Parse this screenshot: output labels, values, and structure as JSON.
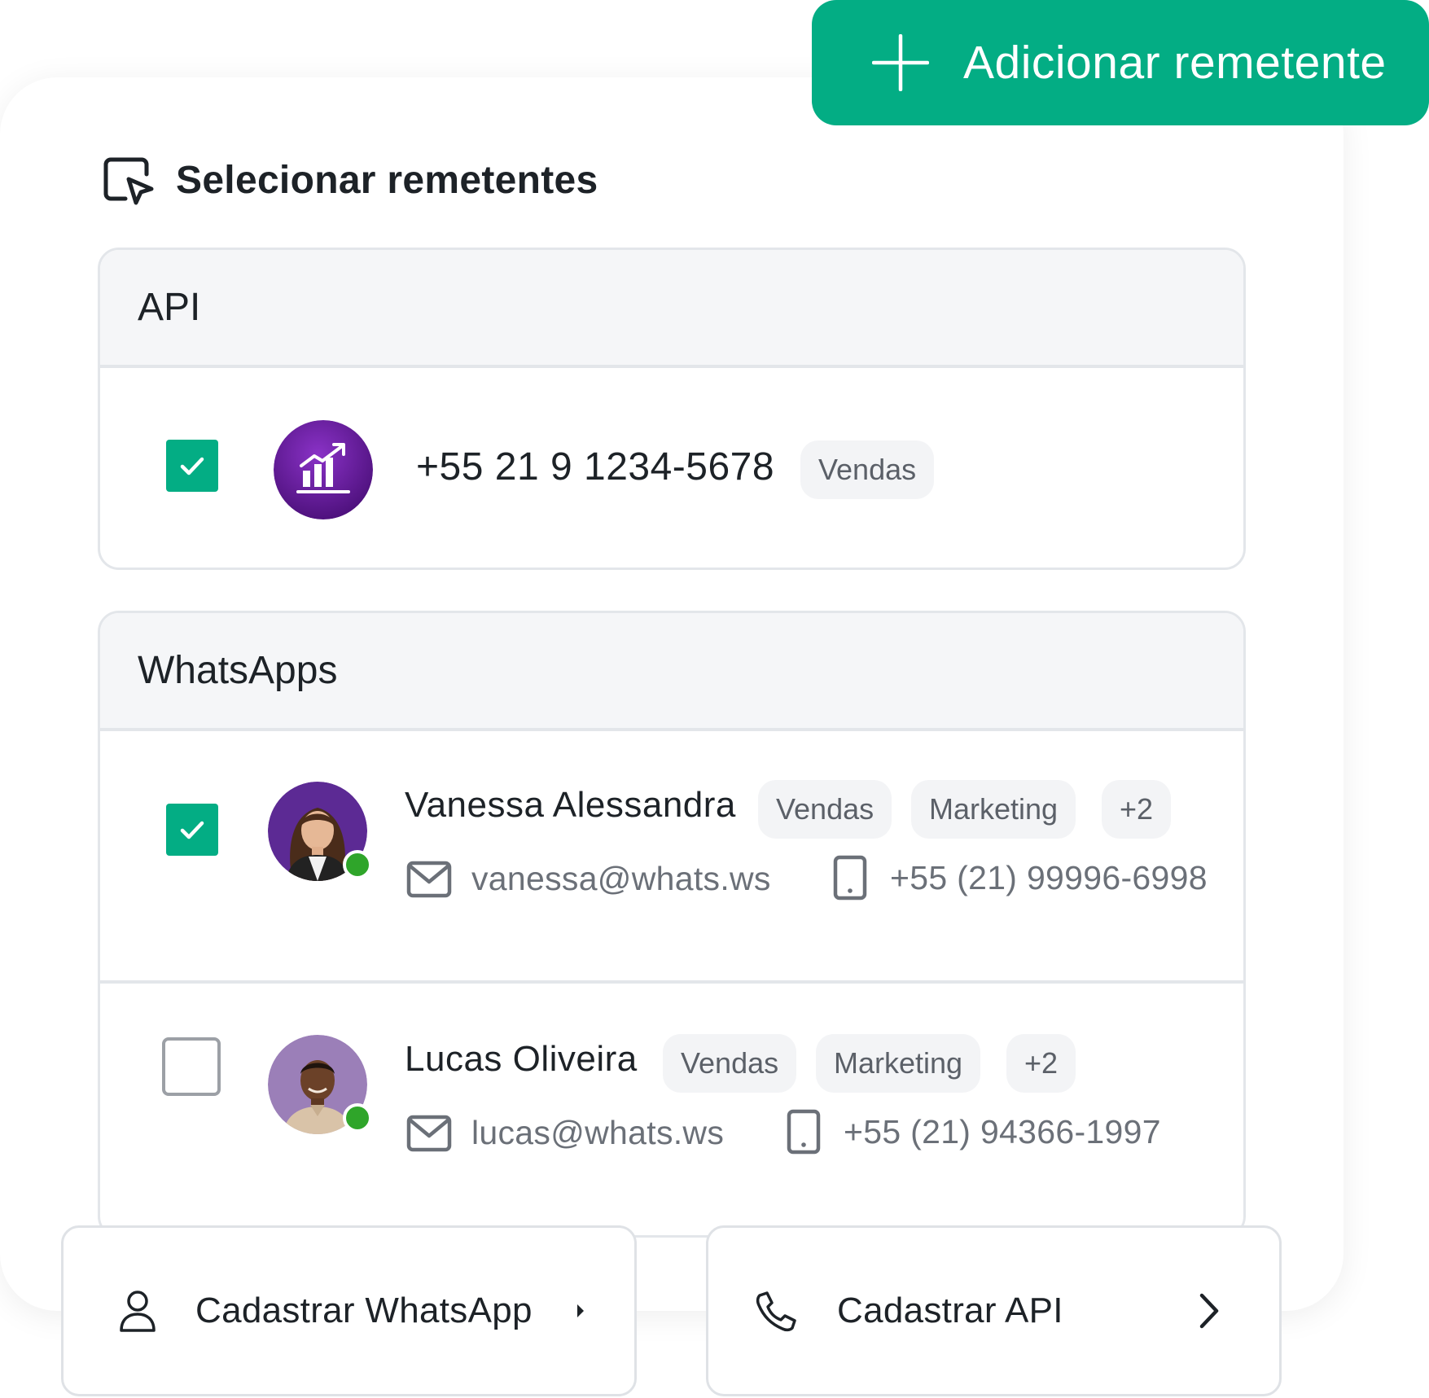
{
  "add_button": {
    "label": "Adicionar remetente",
    "icon": "plus-icon",
    "color": "#03ad84"
  },
  "section": {
    "title": "Selecionar remetentes",
    "icon": "select-cursor-icon"
  },
  "api_group": {
    "title": "API",
    "sender": {
      "checked": true,
      "avatar_icon": "chart-growth-icon",
      "avatar_color": "#6a1fa0",
      "phone": "+55 21 9 1234-5678",
      "tag": "Vendas"
    }
  },
  "whatsapp_group": {
    "title": "WhatsApps",
    "senders": [
      {
        "checked": true,
        "name": "Vanessa Alessandra",
        "tags": [
          "Vendas",
          "Marketing",
          "+2"
        ],
        "email": "vanessa@whats.ws",
        "phone": "+55 (21) 99996-6998",
        "online": true
      },
      {
        "checked": false,
        "name": "Lucas Oliveira",
        "tags": [
          "Vendas",
          "Marketing",
          "+2"
        ],
        "email": "lucas@whats.ws",
        "phone": "+55 (21) 94366-1997",
        "online": true
      }
    ]
  },
  "footer": {
    "register_whatsapp": {
      "label": "Cadastrar WhatsApp",
      "icon": "user-icon"
    },
    "register_api": {
      "label": "Cadastrar API",
      "icon": "phone-icon"
    }
  },
  "colors": {
    "accent": "#03ad84",
    "online": "#2fa52a",
    "tag_bg": "#f3f4f6"
  }
}
